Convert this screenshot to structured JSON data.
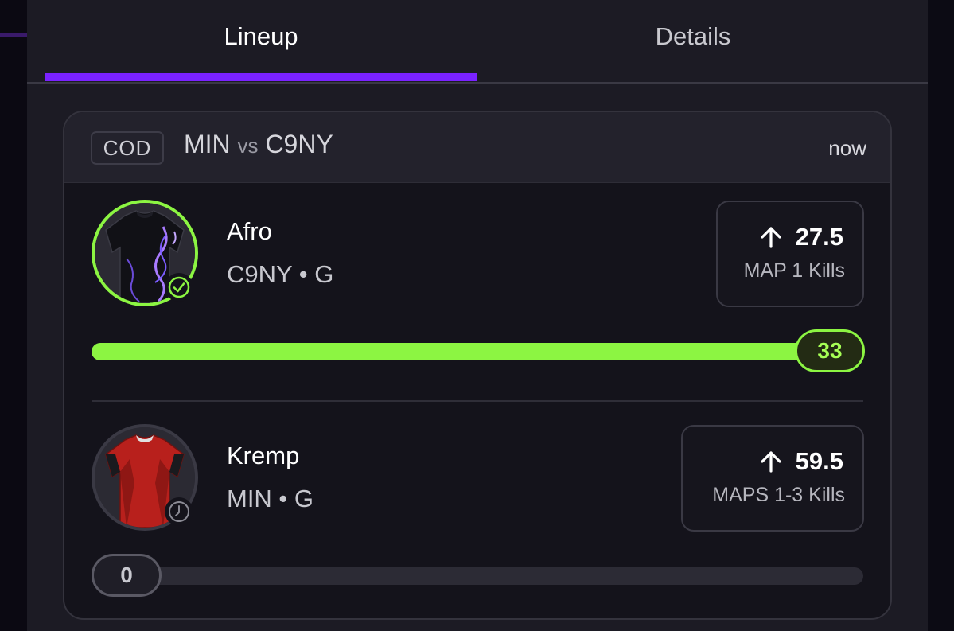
{
  "tabs": [
    {
      "label": "Lineup",
      "active": true
    },
    {
      "label": "Details",
      "active": false
    }
  ],
  "colors": {
    "accent": "#7a22ff",
    "success": "#8cf542",
    "background": "#1c1b24"
  },
  "card": {
    "league": "COD",
    "team_a": "MIN",
    "vs": "vs",
    "team_b": "C9NY",
    "time": "now"
  },
  "players": [
    {
      "name": "Afro",
      "meta": "C9NY • G",
      "status_icon": "check-circle-icon",
      "jersey": "black-purple-jersey",
      "direction_icon": "arrow-up-icon",
      "line": "27.5",
      "stat": "MAP 1 Kills",
      "current": "33",
      "progress": 1.0
    },
    {
      "name": "Kremp",
      "meta": "MIN • G",
      "status_icon": "clock-icon",
      "jersey": "red-jersey",
      "direction_icon": "arrow-up-icon",
      "line": "59.5",
      "stat": "MAPS 1-3 Kills",
      "current": "0",
      "progress": 0.0
    }
  ]
}
